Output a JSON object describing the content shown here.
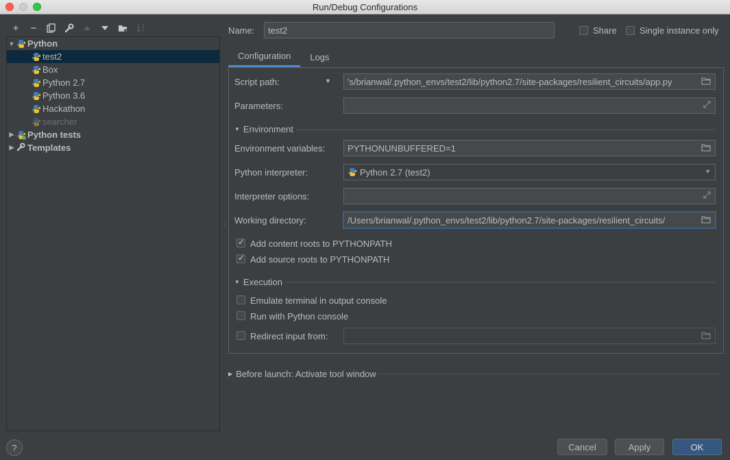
{
  "window": {
    "title": "Run/Debug Configurations"
  },
  "toolbar": {
    "add": "+",
    "remove": "−"
  },
  "tree": {
    "python": "Python",
    "items": [
      "test2",
      "Box",
      "Python 2.7",
      "Python 3.6",
      "Hackathon",
      "searcher"
    ],
    "python_tests": "Python tests",
    "templates": "Templates"
  },
  "header": {
    "name_label": "Name:",
    "name_value": "test2",
    "share_label": "Share",
    "single_instance_label": "Single instance only"
  },
  "tabs": [
    "Configuration",
    "Logs"
  ],
  "config": {
    "script_path_label": "Script path:",
    "script_path_value": "'s/brianwal/.python_envs/test2/lib/python2.7/site-packages/resilient_circuits/app.py",
    "parameters_label": "Parameters:",
    "parameters_value": "",
    "environment_section": "Environment",
    "env_vars_label": "Environment variables:",
    "env_vars_value": "PYTHONUNBUFFERED=1",
    "interpreter_label": "Python interpreter:",
    "interpreter_value": "Python 2.7 (test2)",
    "interpreter_options_label": "Interpreter options:",
    "interpreter_options_value": "",
    "working_dir_label": "Working directory:",
    "working_dir_value": "/Users/brianwal/.python_envs/test2/lib/python2.7/site-packages/resilient_circuits/",
    "add_content_roots": "Add content roots to PYTHONPATH",
    "add_content_roots_checked": true,
    "add_source_roots": "Add source roots to PYTHONPATH",
    "add_source_roots_checked": true,
    "execution_section": "Execution",
    "emulate_terminal": "Emulate terminal in output console",
    "run_with_console": "Run with Python console",
    "redirect_input": "Redirect input from:",
    "redirect_input_value": ""
  },
  "before_launch": "Before launch: Activate tool window",
  "buttons": {
    "help": "?",
    "cancel": "Cancel",
    "apply": "Apply",
    "ok": "OK"
  },
  "colors": {
    "background": "#3c3f41",
    "selection": "#0d293e",
    "accent": "#4a88c7",
    "primary_button": "#365880"
  }
}
